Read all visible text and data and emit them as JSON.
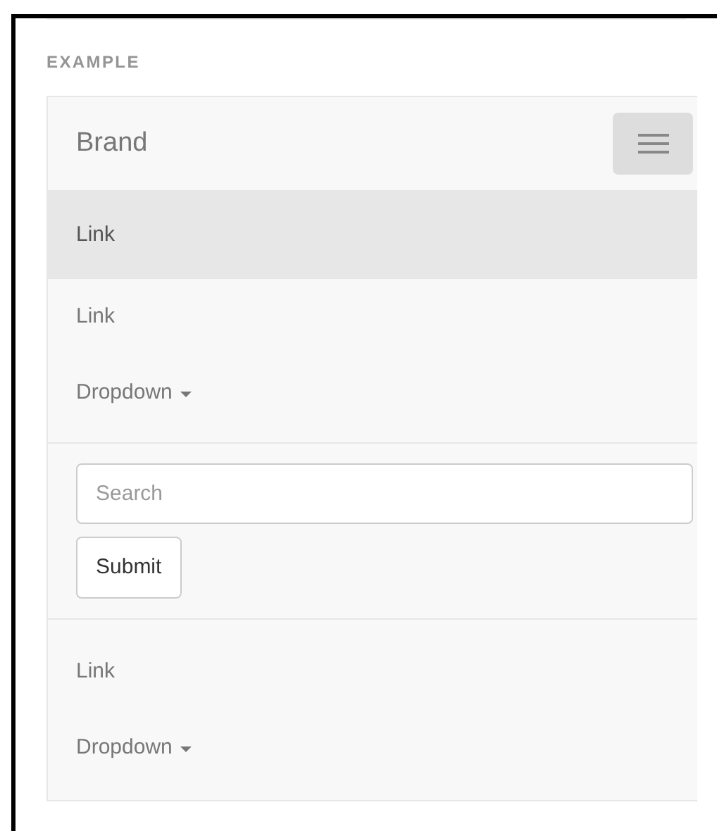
{
  "section_label": "EXAMPLE",
  "navbar": {
    "brand": "Brand",
    "nav_primary": [
      {
        "kind": "link",
        "label": "Link",
        "selected": true
      },
      {
        "kind": "link",
        "label": "Link",
        "selected": false
      },
      {
        "kind": "dropdown",
        "label": "Dropdown",
        "selected": false
      }
    ],
    "search": {
      "placeholder": "Search"
    },
    "submit": "Submit",
    "nav_secondary": [
      {
        "kind": "link",
        "label": "Link",
        "selected": false
      },
      {
        "kind": "dropdown",
        "label": "Dropdown",
        "selected": false
      }
    ]
  }
}
